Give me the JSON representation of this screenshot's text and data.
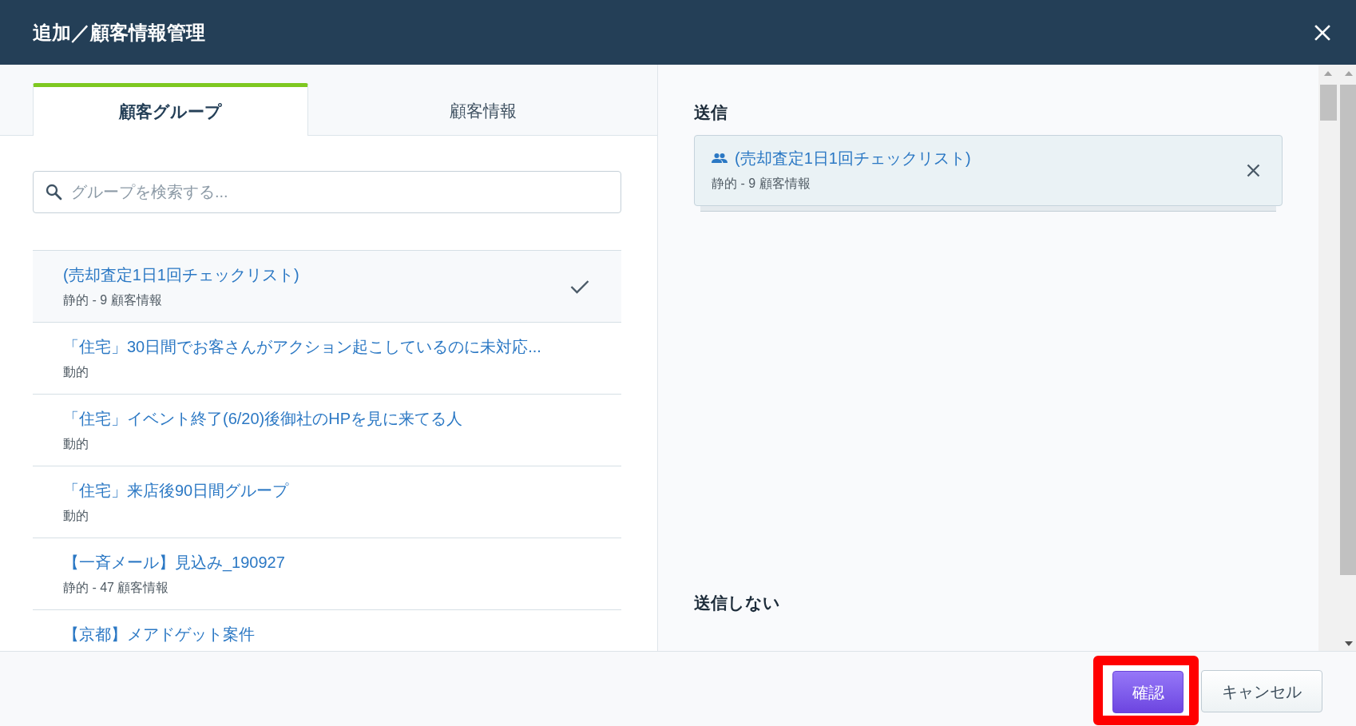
{
  "window": {
    "title": "追加／顧客情報管理"
  },
  "tabs": [
    {
      "label": "顧客グループ",
      "selected": true
    },
    {
      "label": "顧客情報",
      "selected": false
    }
  ],
  "search": {
    "placeholder": "グループを検索する..."
  },
  "groups": [
    {
      "name": "(売却査定1日1回チェックリスト)",
      "detail": "静的 - 9 顧客情報",
      "selected": true
    },
    {
      "name": "「住宅」30日間でお客さんがアクション起こしているのに未対応...",
      "detail": "動的",
      "selected": false
    },
    {
      "name": "「住宅」イベント終了(6/20)後御社のHPを見に来てる人",
      "detail": "動的",
      "selected": false
    },
    {
      "name": "「住宅」来店後90日間グループ",
      "detail": "動的",
      "selected": false
    },
    {
      "name": "【一斉メール】見込み_190927",
      "detail": "静的 - 47 顧客情報",
      "selected": false
    },
    {
      "name": "【京都】メアドゲット案件",
      "selected": false
    }
  ],
  "send": {
    "heading": "送信",
    "recipients": [
      {
        "name": "(売却査定1日1回チェックリスト)",
        "detail": "静的 - 9 顧客情報"
      }
    ]
  },
  "exclude": {
    "heading": "送信しない"
  },
  "buttons": [
    {
      "label": "確認",
      "kind": "primary",
      "highlighted": true
    },
    {
      "label": "キャンセル",
      "kind": "secondary",
      "highlighted": false
    }
  ]
}
